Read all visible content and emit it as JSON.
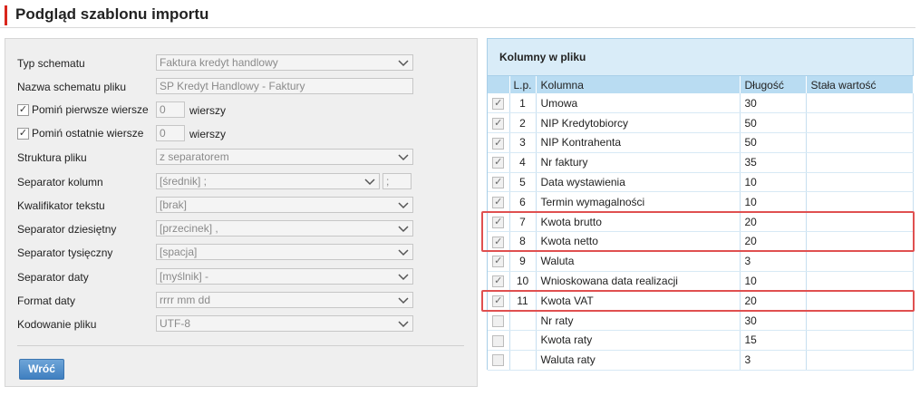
{
  "page": {
    "title": "Podgląd szablonu importu"
  },
  "form": {
    "schema_type": {
      "label": "Typ schematu",
      "value": "Faktura kredyt handlowy"
    },
    "file_schema_name": {
      "label": "Nazwa schematu pliku",
      "value": "SP Kredyt Handlowy - Faktury"
    },
    "skip_first": {
      "label": "Pomiń pierwsze wiersze",
      "value": "0",
      "unit": "wierszy",
      "checked": true
    },
    "skip_last": {
      "label": "Pomiń ostatnie wiersze",
      "value": "0",
      "unit": "wierszy",
      "checked": true
    },
    "file_structure": {
      "label": "Struktura pliku",
      "value": "z separatorem"
    },
    "column_separator": {
      "label": "Separator kolumn",
      "value": "[średnik] ;",
      "extra": ";"
    },
    "text_qualifier": {
      "label": "Kwalifikator tekstu",
      "value": "[brak]"
    },
    "decimal_separator": {
      "label": "Separator dziesiętny",
      "value": "[przecinek] ,"
    },
    "thousands_separator": {
      "label": "Separator tysięczny",
      "value": "[spacja]"
    },
    "date_separator": {
      "label": "Separator daty",
      "value": "[myślnik] -"
    },
    "date_format": {
      "label": "Format daty",
      "value": "rrrr mm dd"
    },
    "file_encoding": {
      "label": "Kodowanie pliku",
      "value": "UTF-8"
    },
    "back_button": "Wróć"
  },
  "columns_panel": {
    "title": "Kolumny w pliku",
    "headers": {
      "lp": "L.p.",
      "column": "Kolumna",
      "length": "Długość",
      "constant": "Stała wartość"
    },
    "rows": [
      {
        "checked": true,
        "lp": "1",
        "column": "Umowa",
        "length": "30",
        "constant": ""
      },
      {
        "checked": true,
        "lp": "2",
        "column": "NIP Kredytobiorcy",
        "length": "50",
        "constant": ""
      },
      {
        "checked": true,
        "lp": "3",
        "column": "NIP Kontrahenta",
        "length": "50",
        "constant": ""
      },
      {
        "checked": true,
        "lp": "4",
        "column": "Nr faktury",
        "length": "35",
        "constant": ""
      },
      {
        "checked": true,
        "lp": "5",
        "column": "Data wystawienia",
        "length": "10",
        "constant": ""
      },
      {
        "checked": true,
        "lp": "6",
        "column": "Termin wymagalności",
        "length": "10",
        "constant": ""
      },
      {
        "checked": true,
        "lp": "7",
        "column": "Kwota brutto",
        "length": "20",
        "constant": ""
      },
      {
        "checked": true,
        "lp": "8",
        "column": "Kwota netto",
        "length": "20",
        "constant": ""
      },
      {
        "checked": true,
        "lp": "9",
        "column": "Waluta",
        "length": "3",
        "constant": ""
      },
      {
        "checked": true,
        "lp": "10",
        "column": "Wnioskowana data realizacji",
        "length": "10",
        "constant": ""
      },
      {
        "checked": true,
        "lp": "11",
        "column": "Kwota VAT",
        "length": "20",
        "constant": ""
      },
      {
        "checked": false,
        "lp": "",
        "column": "Nr raty",
        "length": "30",
        "constant": ""
      },
      {
        "checked": false,
        "lp": "",
        "column": "Kwota raty",
        "length": "15",
        "constant": ""
      },
      {
        "checked": false,
        "lp": "",
        "column": "Waluta raty",
        "length": "3",
        "constant": ""
      }
    ]
  },
  "colors": {
    "accent_red": "#d9261c",
    "header_blue": "#b9dcf2",
    "title_blue": "#d9ecf8",
    "highlight": "#e05050"
  }
}
